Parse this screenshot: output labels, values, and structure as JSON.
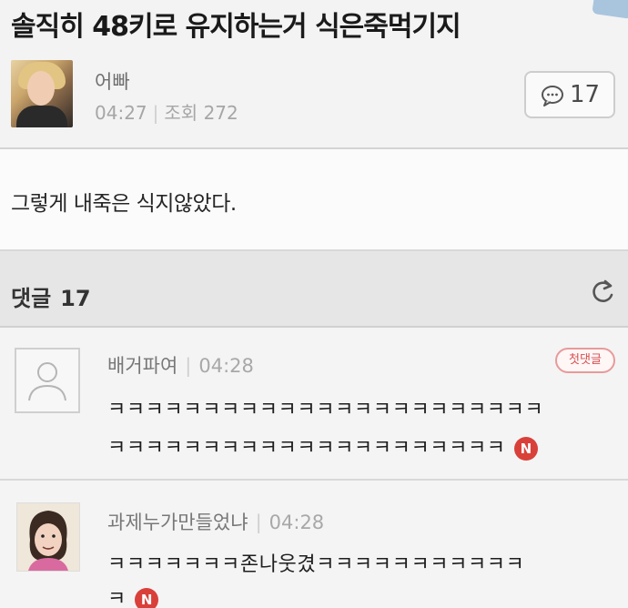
{
  "post": {
    "title": "솔직히 48키로 유지하는거 식은죽먹기지",
    "author": "어빠",
    "time": "04:27",
    "views_label": "조회",
    "views": "272",
    "comment_count": "17",
    "body": "그렇게 내죽은 식지않았다."
  },
  "comments_header": {
    "label": "댓글",
    "count": "17"
  },
  "comments": [
    {
      "author": "배거파여",
      "time": "04:28",
      "badge": "첫댓글",
      "lines": [
        "ㅋㅋㅋㅋㅋㅋㅋㅋㅋㅋㅋㅋㅋㅋㅋㅋㅋㅋㅋㅋㅋㅋㅋ",
        "ㅋㅋㅋㅋㅋㅋㅋㅋㅋㅋㅋㅋㅋㅋㅋㅋㅋㅋㅋㅋㅋ"
      ],
      "new_badge": "N"
    },
    {
      "author": "과제누가만들었냐",
      "time": "04:28",
      "lines": [
        "ㅋㅋㅋㅋㅋㅋㅋ존나웃겼ㅋㅋㅋㅋㅋㅋㅋㅋㅋㅋㅋ",
        "ㅋ"
      ],
      "new_badge": "N"
    }
  ],
  "icons": {
    "comment_bubble": "speech-bubble-icon",
    "refresh": "refresh-icon",
    "default_profile": "default-profile-icon",
    "new": "new-badge-icon"
  },
  "colors": {
    "new_badge": "#d9403a",
    "first_comment_badge": "#d65050"
  }
}
